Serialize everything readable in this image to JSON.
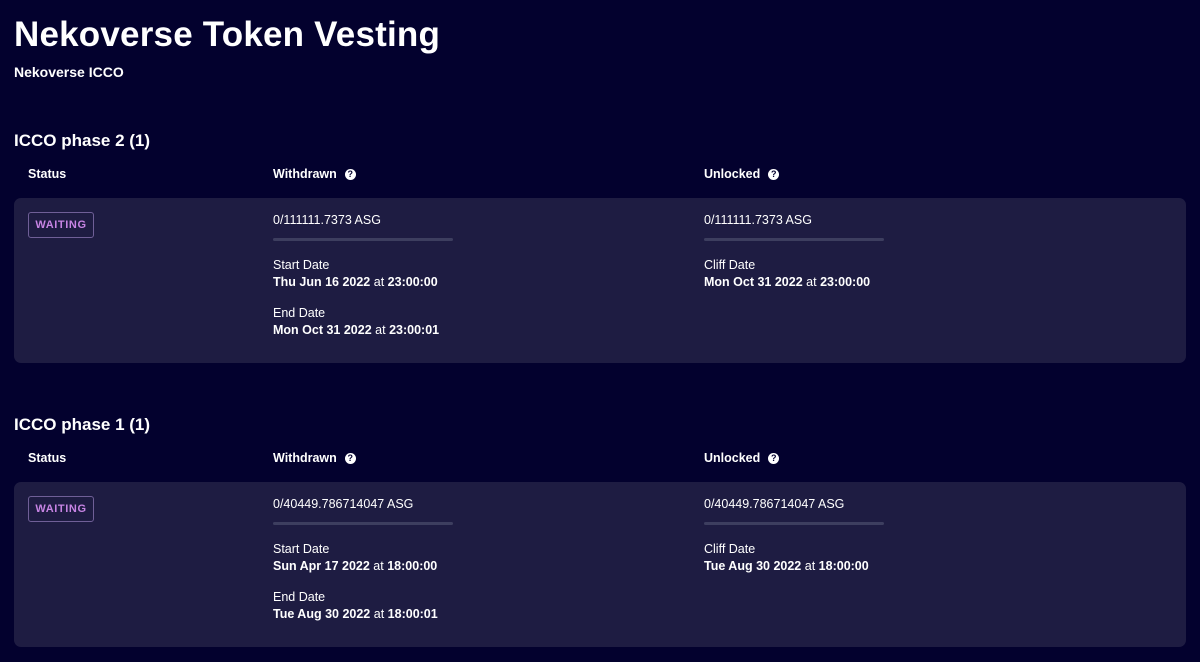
{
  "page": {
    "title": "Nekoverse Token Vesting",
    "subtitle": "Nekoverse ICCO"
  },
  "columns": {
    "status": "Status",
    "withdrawn": "Withdrawn",
    "unlocked": "Unlocked",
    "help_glyph": "?"
  },
  "sections": [
    {
      "title": "ICCO phase 2 (1)",
      "status": "WAITING",
      "withdrawn_amount": "0/111111.7373 ASG",
      "withdrawn_progress": 0,
      "unlocked_amount": "0/111111.7373 ASG",
      "unlocked_progress": 0,
      "start_label": "Start Date",
      "start_day": "Thu Jun 16 2022",
      "start_time": "23:00:00",
      "end_label": "End Date",
      "end_day": "Mon Oct 31 2022",
      "end_time": "23:00:01",
      "cliff_label": "Cliff Date",
      "cliff_day": "Mon Oct 31 2022",
      "cliff_time": "23:00:00"
    },
    {
      "title": "ICCO phase 1 (1)",
      "status": "WAITING",
      "withdrawn_amount": "0/40449.786714047 ASG",
      "withdrawn_progress": 0,
      "unlocked_amount": "0/40449.786714047 ASG",
      "unlocked_progress": 0,
      "start_label": "Start Date",
      "start_day": "Sun Apr 17 2022",
      "start_time": "18:00:00",
      "end_label": "End Date",
      "end_day": "Tue Aug 30 2022",
      "end_time": "18:00:01",
      "cliff_label": "Cliff Date",
      "cliff_day": "Tue Aug 30 2022",
      "cliff_time": "18:00:00"
    }
  ],
  "labels": {
    "at": "at"
  },
  "colors": {
    "background": "#03012e",
    "card": "#1e1c42",
    "status_waiting": "#c784e4",
    "progress_track": "#3d3e5f"
  }
}
